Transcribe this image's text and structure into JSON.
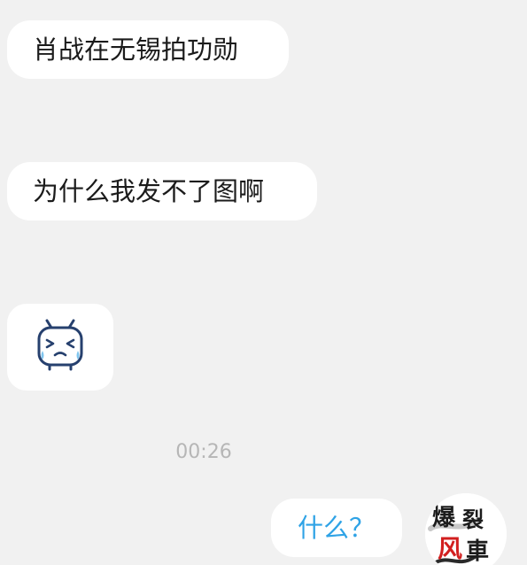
{
  "messages": [
    {
      "side": "left",
      "type": "text",
      "text": "肖战在无锡拍功勋"
    },
    {
      "side": "left",
      "type": "text",
      "text": "为什么我发不了图啊"
    },
    {
      "side": "left",
      "type": "sticker",
      "icon": "crying-tv-face-sticker"
    }
  ],
  "timestamp": "00:26",
  "reply": {
    "side": "right",
    "type": "text",
    "text": "什么？"
  },
  "avatar": {
    "icon": "calligraphy-avatar",
    "glyphs": [
      "爆",
      "裂",
      "风",
      "車"
    ]
  },
  "colors": {
    "background": "#f1f1f1",
    "bubble": "#ffffff",
    "reply_text": "#2fa3e6",
    "timestamp": "#b6b6b6",
    "sticker_line": "#26406e"
  }
}
